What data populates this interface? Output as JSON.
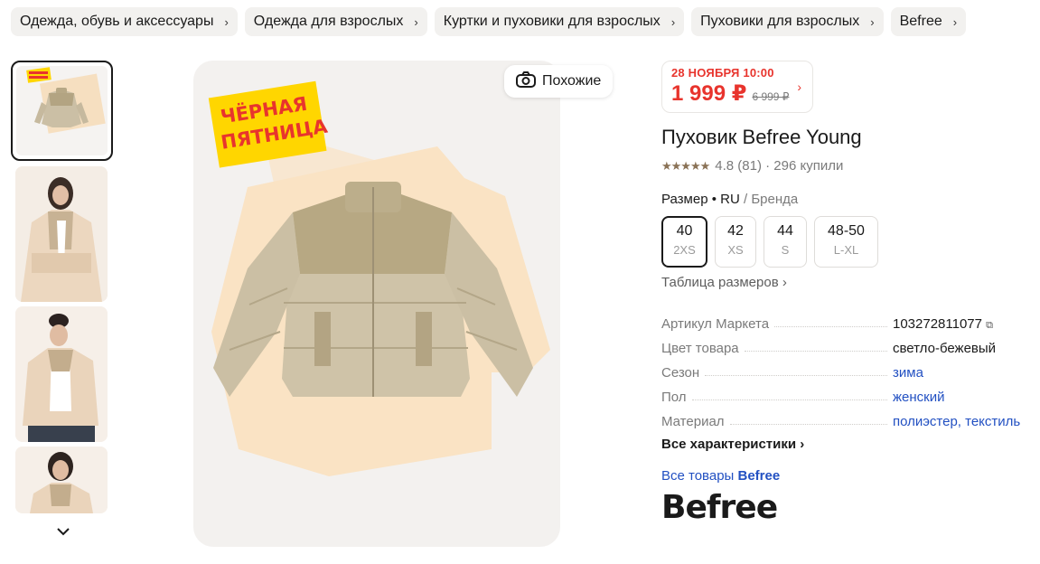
{
  "breadcrumbs": [
    {
      "label": "Одежда, обувь и аксессуары"
    },
    {
      "label": "Одежда для взрослых"
    },
    {
      "label": "Куртки и пуховики для взрослых"
    },
    {
      "label": "Пуховики для взрослых"
    },
    {
      "label": "Befree"
    }
  ],
  "gallery": {
    "badge_line1": "ЧЁРНАЯ",
    "badge_line2": "ПЯТНИЦА",
    "similar_label": "Похожие"
  },
  "price": {
    "date": "28 НОЯБРЯ 10:00",
    "current": "1 999 ₽",
    "old": "6 999 ₽"
  },
  "product": {
    "title": "Пуховик Befree Young",
    "rating": "4.8 (81) · 296 купили"
  },
  "size": {
    "header": "Размер • RU",
    "header_alt": "/ Бренда",
    "options": [
      {
        "n": "40",
        "s": "2XS"
      },
      {
        "n": "42",
        "s": "XS"
      },
      {
        "n": "44",
        "s": "S"
      },
      {
        "n": "48-50",
        "s": "L-XL"
      }
    ],
    "table_link": "Таблица размеров"
  },
  "specs": [
    {
      "k": "Артикул Маркета",
      "v": "103272811077"
    },
    {
      "k": "Цвет товара",
      "v": "светло-бежевый"
    },
    {
      "k": "Сезон",
      "v": "зима"
    },
    {
      "k": "Пол",
      "v": "женский"
    },
    {
      "k": "Материал",
      "v": "полиэстер, текстиль"
    }
  ],
  "links": {
    "all_specs": "Все характеристики",
    "all_goods_prefix": "Все товары",
    "all_goods_brand": "Befree"
  },
  "brand_logo": "Befree",
  "colors": {
    "accent_red": "#e8342d",
    "link_blue": "#2250c2",
    "badge_yellow": "#ffd600"
  }
}
